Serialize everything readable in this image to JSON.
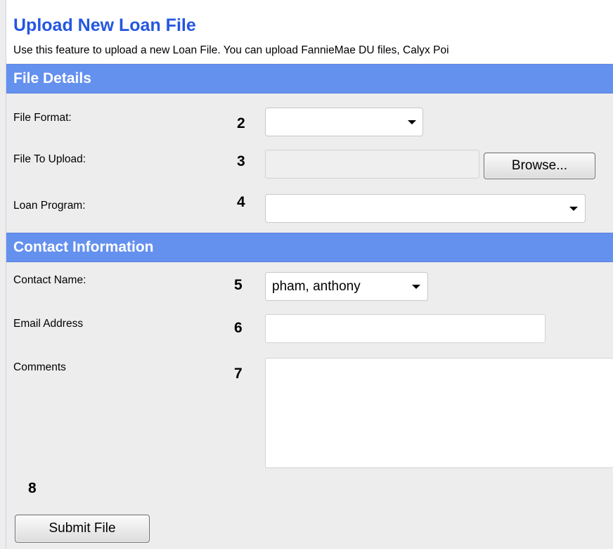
{
  "header": {
    "title": "Upload New Loan File",
    "description": "Use this feature to upload a new Loan File. You can upload FannieMae DU files, Calyx Poi"
  },
  "file_details": {
    "section_title": "File Details",
    "file_format": {
      "label": "File Format:",
      "number": "2",
      "value": ""
    },
    "file_to_upload": {
      "label": "File To Upload:",
      "number": "3",
      "value": "",
      "browse_label": "Browse..."
    },
    "loan_program": {
      "label": "Loan Program:",
      "number": "4",
      "value": ""
    }
  },
  "contact_info": {
    "section_title": "Contact Information",
    "contact_name": {
      "label": "Contact Name:",
      "number": "5",
      "value": "pham, anthony"
    },
    "email_address": {
      "label": "Email Address",
      "number": "6",
      "value": ""
    },
    "comments": {
      "label": "Comments",
      "number": "7",
      "value": ""
    }
  },
  "submit": {
    "number": "8",
    "label": "Submit File"
  }
}
